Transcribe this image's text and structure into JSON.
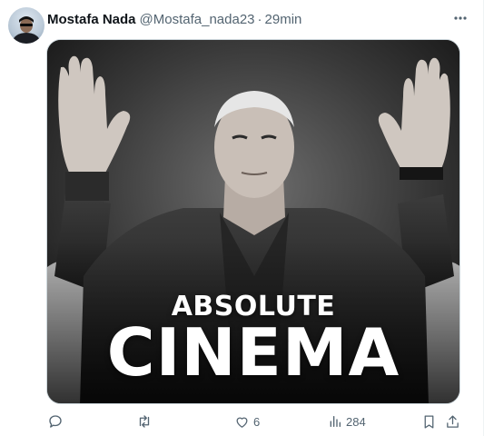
{
  "author": {
    "name": "Mostafa Nada",
    "handle": "@Mostafa_nada23",
    "separator": "·",
    "time": "29min"
  },
  "media": {
    "caption_top": "ABSOLUTE",
    "caption_bottom": "CINEMA"
  },
  "actions": {
    "reply_icon": "reply-icon",
    "retweet_icon": "retweet-icon",
    "like_icon": "heart-icon",
    "like_count": "6",
    "views_icon": "views-icon",
    "views_count": "284",
    "bookmark_icon": "bookmark-icon",
    "share_icon": "share-icon"
  },
  "colors": {
    "text_primary": "#0f1419",
    "text_secondary": "#536471",
    "border": "#cfd9de"
  }
}
